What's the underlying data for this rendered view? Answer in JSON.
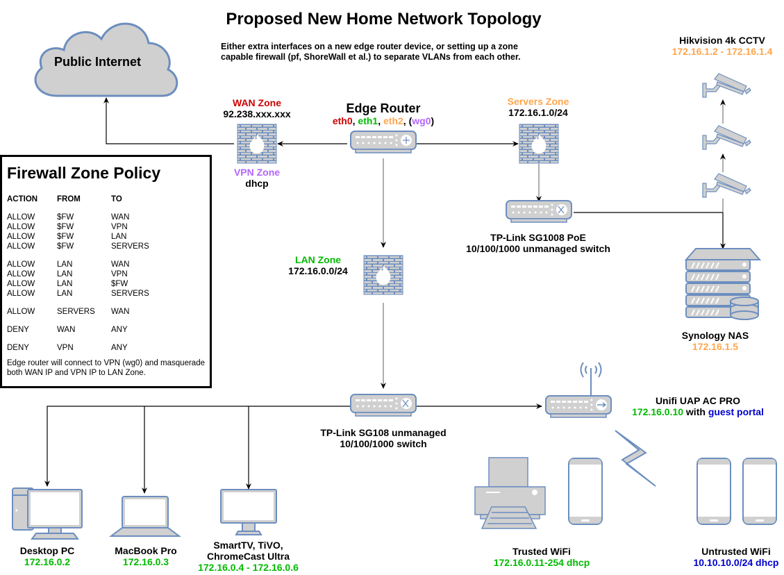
{
  "title": "Proposed New Home Network Topology",
  "subtitle": "Either extra interfaces on a new edge router device, or setting up a zone capable firewall (pf, ShoreWall et al.) to separate VLANs from each other.",
  "colors": {
    "device_fill": "#d0d0d0",
    "device_stroke": "#6c8ebf",
    "wan": "#cc0000",
    "lan": "#00bb00",
    "servers": "#ffa64d",
    "vpn": "#b266ff",
    "guest": "#0000cc"
  },
  "internet": {
    "label": "Public Internet"
  },
  "wan_zone": {
    "label": "WAN Zone",
    "address": "92.238.xxx.xxx"
  },
  "vpn_zone": {
    "label": "VPN Zone",
    "address": "dhcp"
  },
  "edge_router": {
    "label": "Edge Router",
    "interfaces": [
      {
        "name": "eth0",
        "zone": "wan",
        "sep": ", "
      },
      {
        "name": "eth1",
        "zone": "lan",
        "sep": ", "
      },
      {
        "name": "eth2",
        "zone": "servers",
        "sep": ", ("
      },
      {
        "name": "wg0",
        "zone": "vpn",
        "sep": ")"
      }
    ]
  },
  "servers_zone": {
    "label": "Servers Zone",
    "address": "172.16.1.0/24"
  },
  "lan_zone": {
    "label": "LAN Zone",
    "address": "172.16.0.0/24"
  },
  "cctv": {
    "label": "Hikvision 4k CCTV",
    "address": "172.16.1.2 - 172.16.1.4"
  },
  "poe_switch": {
    "line1": "TP-Link SG1008 PoE",
    "line2": "10/100/1000 unmanaged switch"
  },
  "nas": {
    "label": "Synology NAS",
    "address": "172.16.1.5"
  },
  "lan_switch": {
    "line1": "TP-Link SG108 unmanaged",
    "line2": "10/100/1000 switch"
  },
  "ap": {
    "label": "Unifi UAP AC PRO",
    "address": "172.16.0.10",
    "with": " with ",
    "guest": "guest portal"
  },
  "desktop": {
    "label": "Desktop PC",
    "address": "172.16.0.2"
  },
  "macbook": {
    "label": "MacBook Pro",
    "address": "172.16.0.3"
  },
  "tv": {
    "line1": "SmartTV, TiVO,",
    "line2": "ChromeCast Ultra",
    "address": "172.16.0.4 - 172.16.0.6"
  },
  "trusted_wifi": {
    "label": "Trusted WiFi",
    "address": "172.16.0.11-254 dhcp"
  },
  "untrusted_wifi": {
    "label": "Untrusted WiFi",
    "address": "10.10.10.0/24 dhcp"
  },
  "policy": {
    "title": "Firewall Zone Policy",
    "headers": [
      "ACTION",
      "FROM",
      "TO"
    ],
    "groups": [
      [
        [
          "ALLOW",
          "$FW",
          "WAN"
        ],
        [
          "ALLOW",
          "$FW",
          "VPN"
        ],
        [
          "ALLOW",
          "$FW",
          "LAN"
        ],
        [
          "ALLOW",
          "$FW",
          "SERVERS"
        ]
      ],
      [
        [
          "ALLOW",
          "LAN",
          "WAN"
        ],
        [
          "ALLOW",
          "LAN",
          "VPN"
        ],
        [
          "ALLOW",
          "LAN",
          "$FW"
        ],
        [
          "ALLOW",
          "LAN",
          "SERVERS"
        ]
      ],
      [
        [
          "ALLOW",
          "SERVERS",
          "WAN"
        ]
      ],
      [
        [
          "DENY",
          "WAN",
          "ANY"
        ]
      ],
      [
        [
          "DENY",
          "VPN",
          "ANY"
        ]
      ]
    ],
    "note": "Edge router will connect to VPN (wg0) and masquerade both WAN IP and VPN IP to LAN Zone."
  }
}
